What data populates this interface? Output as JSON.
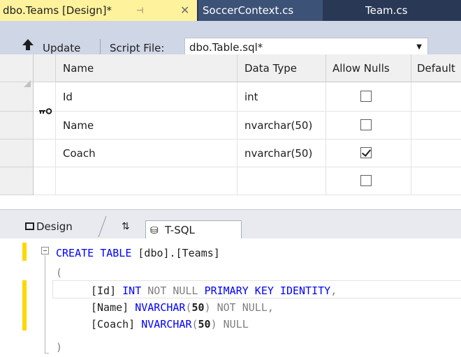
{
  "tabs": [
    {
      "label": "dbo.Teams [Design]*",
      "active": true
    },
    {
      "label": "SoccerContext.cs",
      "active": false
    },
    {
      "label": "Team.cs",
      "active": false
    }
  ],
  "tab_icons": {
    "pin": "pin-icon",
    "close": "close-icon"
  },
  "toolbar": {
    "update_label": "Update",
    "script_file_label": "Script File:",
    "script_file_value": "dbo.Table.sql*"
  },
  "grid": {
    "columns": [
      "Name",
      "Data Type",
      "Allow Nulls",
      "Default"
    ],
    "rows": [
      {
        "name": "Id",
        "type": "int",
        "allow_nulls": false,
        "primary_key": true
      },
      {
        "name": "Name",
        "type": "nvarchar(50)",
        "allow_nulls": false,
        "primary_key": false
      },
      {
        "name": "Coach",
        "type": "nvarchar(50)",
        "allow_nulls": true,
        "primary_key": false
      },
      {
        "name": "",
        "type": "",
        "allow_nulls": false,
        "primary_key": false
      }
    ]
  },
  "pane_tabs": {
    "design": "Design",
    "swap": "⇅",
    "tsql": "T-SQL"
  },
  "code": {
    "line1": {
      "kw": "CREATE TABLE",
      "rest": " [dbo].[Teams]"
    },
    "line2": "(",
    "line3": {
      "a": "[Id]",
      "b": "INT",
      "c": "NOT NULL",
      "d": "PRIMARY KEY IDENTITY",
      "e": ","
    },
    "line4": {
      "a": "[Name]",
      "b": "NVARCHAR",
      "c": "(",
      "d": "50",
      "e": ")",
      "f": "NOT NULL",
      "g": ","
    },
    "line5": {
      "a": "[Coach]",
      "b": "NVARCHAR",
      "c": "(",
      "d": "50",
      "e": ")",
      "f": "NULL"
    },
    "line6": ")"
  },
  "colors": {
    "tab_active": "#fff29d",
    "tab_strip": "#293955",
    "toolbar": "#cfd6e5",
    "change_marker": "#fbd900"
  }
}
